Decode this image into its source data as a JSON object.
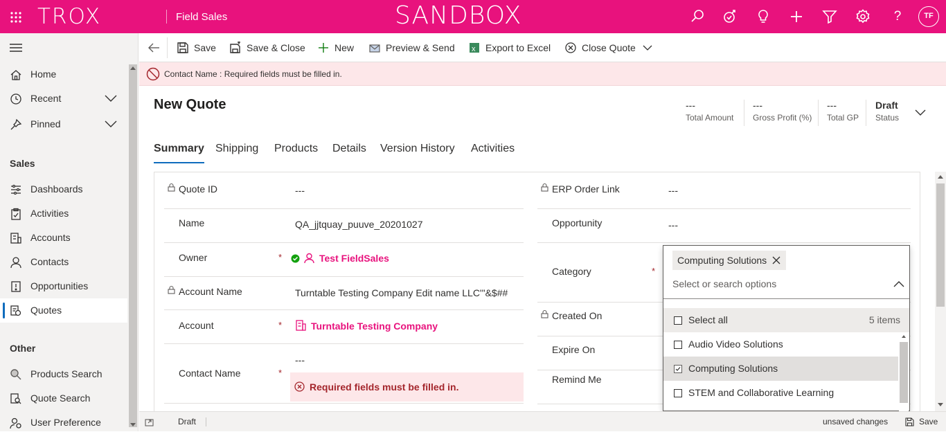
{
  "topbar": {
    "logo": "TROX",
    "app_name": "Field Sales",
    "environment": "SANDBOX",
    "avatar": "TF",
    "icons": [
      "search-icon",
      "task-icon",
      "lightbulb-icon",
      "plus-icon",
      "filter-icon",
      "settings-icon",
      "help-icon"
    ],
    "bg_color": "#e8127d"
  },
  "sidebar": {
    "items": [
      {
        "label": "Home",
        "icon": "home-icon"
      },
      {
        "label": "Recent",
        "icon": "clock-icon"
      },
      {
        "label": "Pinned",
        "icon": "pin-icon"
      }
    ],
    "groups": [
      {
        "title": "Sales",
        "items": [
          {
            "label": "Dashboards",
            "icon": "dashboard-icon"
          },
          {
            "label": "Activities",
            "icon": "clipboard-icon"
          },
          {
            "label": "Accounts",
            "icon": "building-icon"
          },
          {
            "label": "Contacts",
            "icon": "person-icon"
          },
          {
            "label": "Opportunities",
            "icon": "lightning-icon"
          },
          {
            "label": "Quotes",
            "icon": "quote-icon",
            "selected": true
          }
        ]
      },
      {
        "title": "Other",
        "items": [
          {
            "label": "Products Search",
            "icon": "search-icon"
          },
          {
            "label": "Quote Search",
            "icon": "quote-search-icon"
          },
          {
            "label": "User Preference",
            "icon": "user-pref-icon"
          }
        ]
      }
    ]
  },
  "commandbar": {
    "items": [
      {
        "label": "Save"
      },
      {
        "label": "Save & Close"
      },
      {
        "label": "New"
      },
      {
        "label": "Preview & Send"
      },
      {
        "label": "Export to Excel"
      },
      {
        "label": "Close Quote"
      }
    ]
  },
  "error_banner": "Contact Name : Required fields must be filled in.",
  "header": {
    "title": "New Quote",
    "kpis": [
      {
        "value": "---",
        "label": "Total Amount"
      },
      {
        "value": "---",
        "label": "Gross Profit (%)"
      },
      {
        "value": "---",
        "label": "Total GP"
      },
      {
        "value": "Draft",
        "label": "Status"
      }
    ]
  },
  "tabs": [
    "Summary",
    "Shipping",
    "Products",
    "Details",
    "Version History",
    "Activities"
  ],
  "form": {
    "left": [
      {
        "label": "Quote ID",
        "value": "---",
        "locked": true
      },
      {
        "label": "Name",
        "value": "QA_jjtquay_puuve_20201027"
      },
      {
        "label": "Owner",
        "value": "Test FieldSales",
        "required": "*"
      },
      {
        "label": "Account Name",
        "value": "Turntable Testing Company Edit name LLC'\"&$##",
        "locked": true
      },
      {
        "label": "Account",
        "value": "Turntable Testing Company",
        "required": "*"
      },
      {
        "label": "Contact Name",
        "value": "---",
        "required": "*",
        "error": "Required fields must be filled in."
      }
    ],
    "right": [
      {
        "label": "ERP Order Link",
        "value": "---",
        "locked": true
      },
      {
        "label": "Opportunity",
        "value": "---"
      },
      {
        "label": "Category",
        "required": "*"
      },
      {
        "label": "Created On",
        "locked": true
      },
      {
        "label": "Expire On"
      },
      {
        "label": "Remind Me"
      }
    ]
  },
  "category_dropdown": {
    "chip": "Computing Solutions",
    "placeholder": "Select or search options",
    "select_all": "Select all",
    "count": "5 items",
    "options": [
      {
        "label": "Audio Video Solutions",
        "checked": false
      },
      {
        "label": "Computing Solutions",
        "checked": true
      },
      {
        "label": "STEM and Collaborative Learning",
        "checked": false
      }
    ]
  },
  "footer": {
    "status": "Draft",
    "unsaved": "unsaved changes",
    "save": "Save"
  }
}
